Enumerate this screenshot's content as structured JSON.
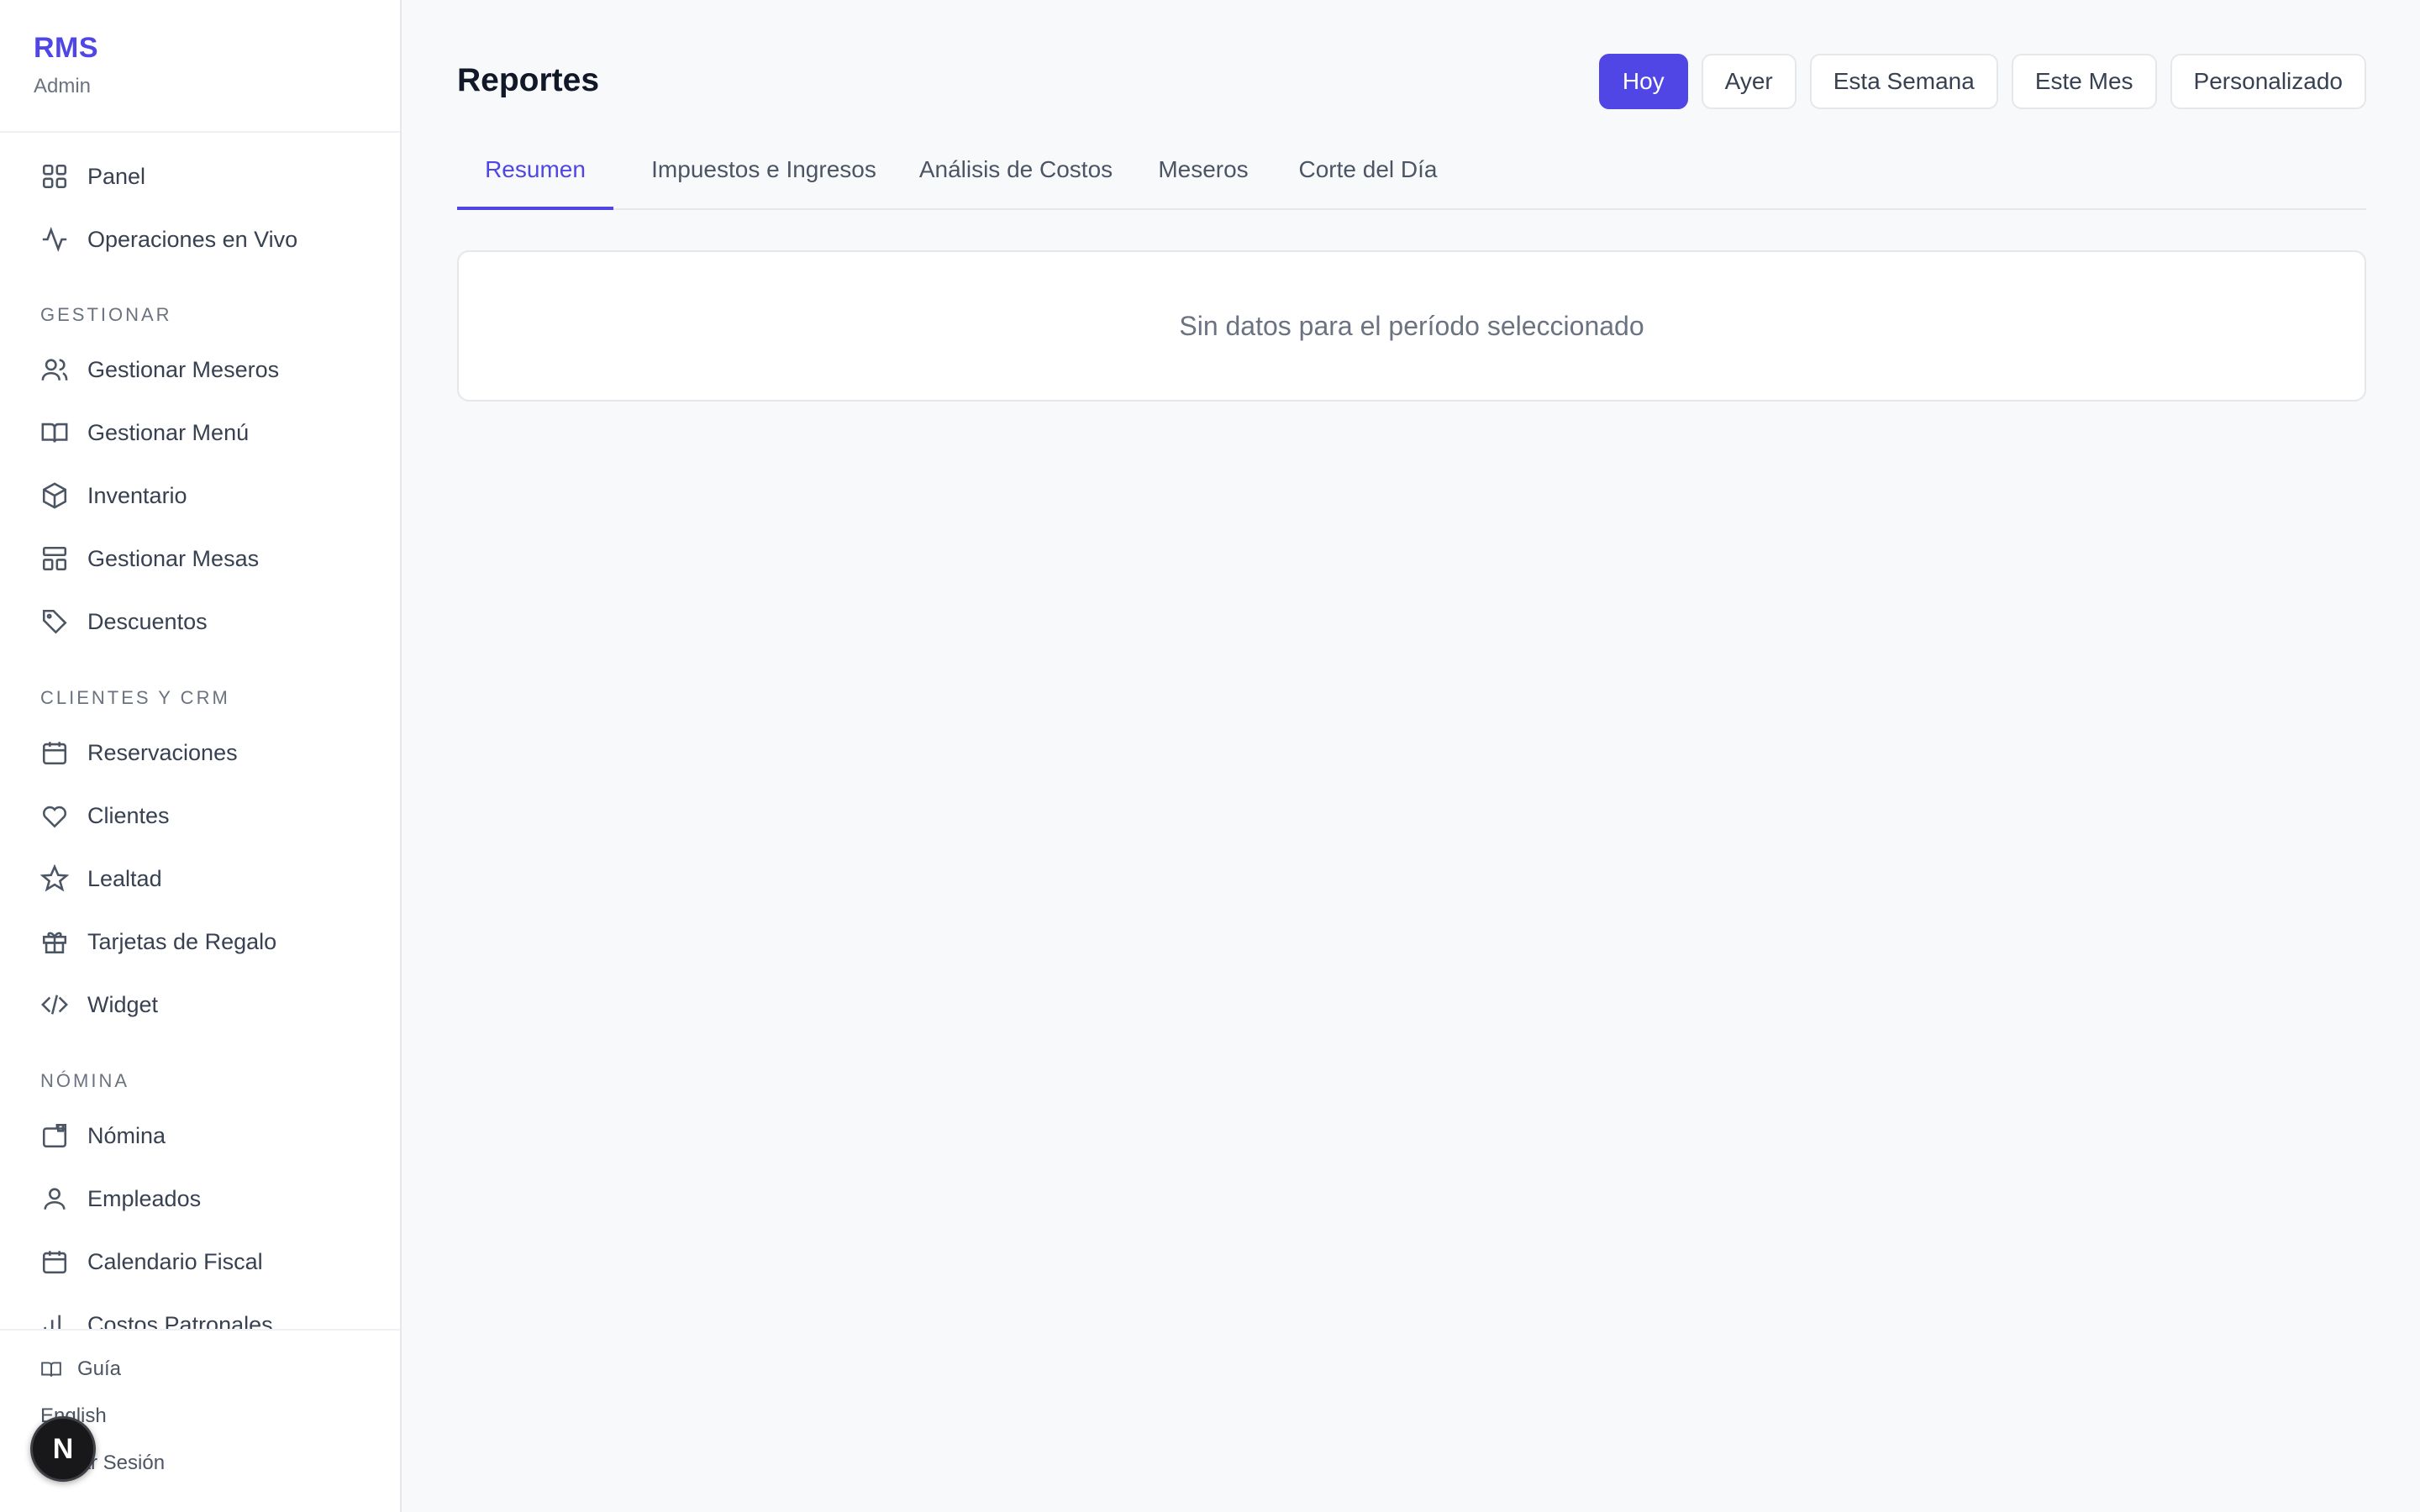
{
  "brand": {
    "title": "RMS",
    "subtitle": "Admin"
  },
  "sidebar": {
    "top_items": [
      {
        "label": "Panel",
        "icon": "grid-icon"
      },
      {
        "label": "Operaciones en Vivo",
        "icon": "activity-icon"
      }
    ],
    "sections": [
      {
        "title": "GESTIONAR",
        "items": [
          {
            "label": "Gestionar Meseros",
            "icon": "users-icon"
          },
          {
            "label": "Gestionar Menú",
            "icon": "book-open-icon"
          },
          {
            "label": "Inventario",
            "icon": "box-icon"
          },
          {
            "label": "Gestionar Mesas",
            "icon": "layout-icon"
          },
          {
            "label": "Descuentos",
            "icon": "tag-icon"
          }
        ]
      },
      {
        "title": "CLIENTES Y CRM",
        "items": [
          {
            "label": "Reservaciones",
            "icon": "calendar-icon"
          },
          {
            "label": "Clientes",
            "icon": "heart-icon"
          },
          {
            "label": "Lealtad",
            "icon": "star-icon"
          },
          {
            "label": "Tarjetas de Regalo",
            "icon": "gift-icon"
          },
          {
            "label": "Widget",
            "icon": "code-icon"
          }
        ]
      },
      {
        "title": "NÓMINA",
        "items": [
          {
            "label": "Nómina",
            "icon": "wallet-icon"
          },
          {
            "label": "Empleados",
            "icon": "user-icon"
          },
          {
            "label": "Calendario Fiscal",
            "icon": "calendar-icon"
          },
          {
            "label": "Costos Patronales",
            "icon": "bar-chart-icon"
          }
        ]
      }
    ],
    "footer": {
      "guide": "Guía",
      "language": "English",
      "logout": "Cerrar Sesión",
      "fab_letter": "N"
    }
  },
  "main": {
    "title": "Reportes",
    "ranges": [
      {
        "label": "Hoy",
        "active": true
      },
      {
        "label": "Ayer",
        "active": false
      },
      {
        "label": "Esta Semana",
        "active": false
      },
      {
        "label": "Este Mes",
        "active": false
      },
      {
        "label": "Personalizado",
        "active": false
      }
    ],
    "tabs": [
      {
        "label": "Resumen",
        "active": true
      },
      {
        "label": "Impuestos e Ingresos",
        "active": false
      },
      {
        "label": "Análisis de Costos",
        "active": false
      },
      {
        "label": "Meseros",
        "active": false
      },
      {
        "label": "Corte del Día",
        "active": false
      }
    ],
    "empty_message": "Sin datos para el período seleccionado"
  },
  "colors": {
    "accent": "#4f46e5",
    "background": "#f8f9fb",
    "sidebar": "#ffffff"
  }
}
